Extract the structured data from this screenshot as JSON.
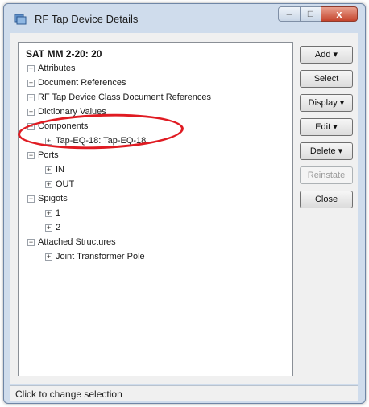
{
  "window": {
    "title": "RF Tap Device Details"
  },
  "titlebar_buttons": {
    "minimize_glyph": "–",
    "maximize_glyph": "□",
    "close_glyph": "x"
  },
  "tree": {
    "title": "SAT MM 2-20: 20",
    "nodes": [
      {
        "label": "Attributes",
        "expander": "+"
      },
      {
        "label": "Document References",
        "expander": "+"
      },
      {
        "label": "RF Tap Device Class Document References",
        "expander": "+"
      },
      {
        "label": "Dictionary Values",
        "expander": "+"
      },
      {
        "label": "Components",
        "expander": "−"
      },
      {
        "label": "Tap-EQ-18: Tap-EQ-18",
        "expander": "+"
      },
      {
        "label": "Ports",
        "expander": "−"
      },
      {
        "label": "IN",
        "expander": "+"
      },
      {
        "label": "OUT",
        "expander": "+"
      },
      {
        "label": "Spigots",
        "expander": "−"
      },
      {
        "label": "1",
        "expander": "+"
      },
      {
        "label": "2",
        "expander": "+"
      },
      {
        "label": "Attached Structures",
        "expander": "−"
      },
      {
        "label": "Joint Transformer Pole",
        "expander": "+"
      }
    ]
  },
  "buttons": {
    "add": "Add ▾",
    "select": "Select",
    "display": "Display ▾",
    "edit": "Edit ▾",
    "delete": "Delete ▾",
    "reinstate": "Reinstate",
    "close": "Close"
  },
  "status_bar": {
    "text": "Click to change selection"
  },
  "colors": {
    "highlight": "#e01b22",
    "window_frame": "#cfdcec"
  }
}
